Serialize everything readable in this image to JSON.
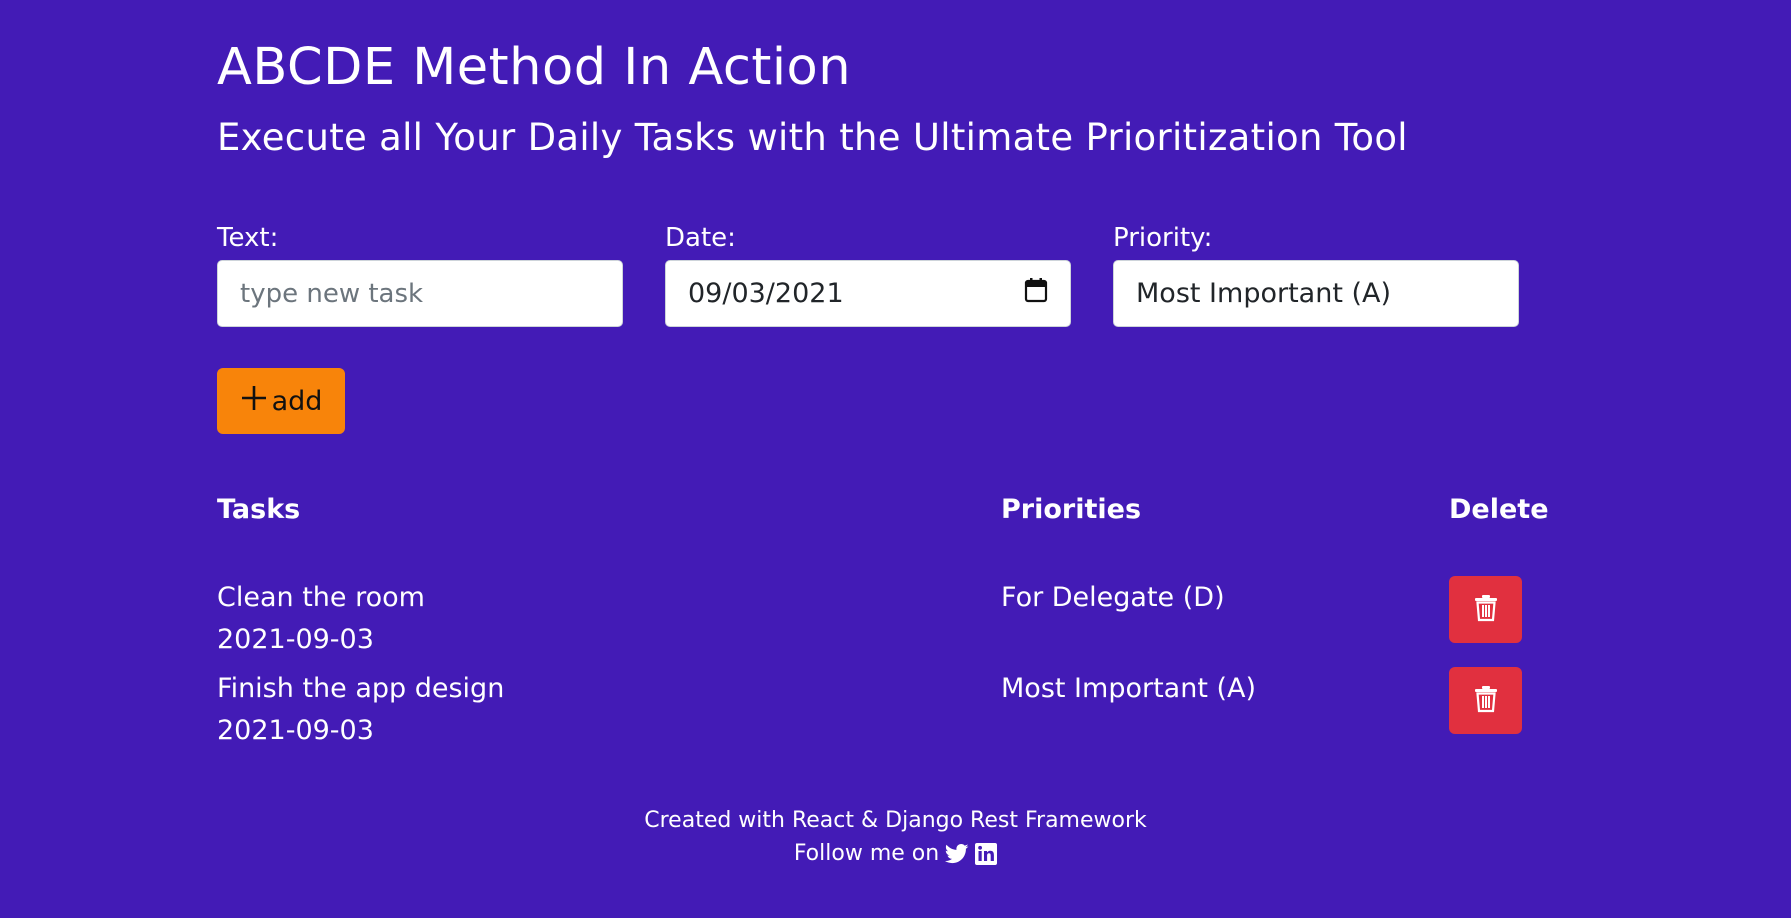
{
  "header": {
    "title": "ABCDE Method In Action",
    "subtitle": "Execute all Your Daily Tasks with the Ultimate Prioritization Tool"
  },
  "form": {
    "text_label": "Text:",
    "text_placeholder": "type new task",
    "date_label": "Date:",
    "date_value": "09/03/2021",
    "priority_label": "Priority:",
    "priority_value": "Most Important (A)",
    "add_label": "add"
  },
  "table": {
    "headers": {
      "tasks": "Tasks",
      "priorities": "Priorities",
      "delete": "Delete"
    },
    "rows": [
      {
        "text": "Clean the room",
        "date": "2021-09-03",
        "priority": "For Delegate (D)"
      },
      {
        "text": "Finish the app design",
        "date": "2021-09-03",
        "priority": "Most Important (A)"
      }
    ]
  },
  "footer": {
    "credit": "Created with React & Django Rest Framework",
    "follow": "Follow me on"
  },
  "icons": {
    "calendar": "calendar-icon",
    "plus": "plus-icon",
    "trash": "trash-icon",
    "twitter": "twitter-icon",
    "linkedin": "linkedin-icon"
  },
  "colors": {
    "background": "#431bb6",
    "add_button": "#f8840a",
    "delete_button": "#e1303f"
  }
}
